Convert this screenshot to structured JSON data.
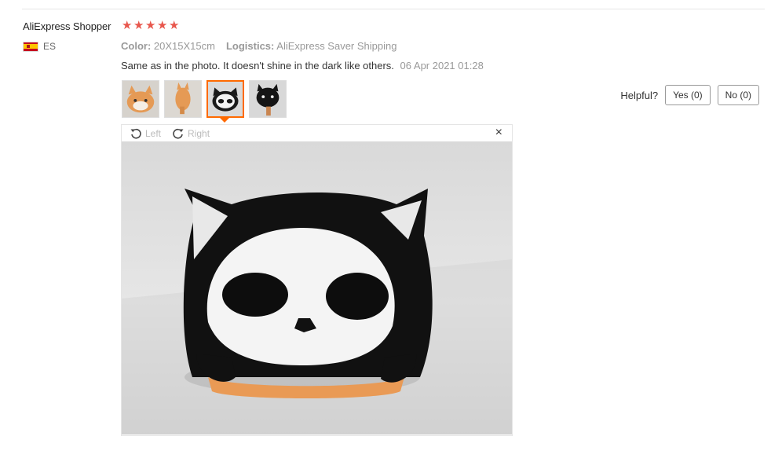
{
  "user": {
    "name": "AliExpress Shopper",
    "country_code": "ES",
    "rating": 5
  },
  "colors": {
    "star": "#e8574d",
    "accent": "#ff6a00"
  },
  "review": {
    "color_label": "Color:",
    "color_value": "20X15X15cm",
    "logistics_label": "Logistics:",
    "logistics_value": "AliExpress Saver Shipping",
    "text": "Same as in the photo. It doesn't shine in the dark like others.",
    "date": "06 Apr 2021 01:28"
  },
  "helpful": {
    "label": "Helpful?",
    "yes": "Yes (0)",
    "no": "No (0)"
  },
  "viewer": {
    "rotate_left": "Left",
    "rotate_right": "Right",
    "close": "×",
    "active_thumb_index": 2
  },
  "thumbnails": [
    {
      "icon": "orange-cat-plush"
    },
    {
      "icon": "orange-cat-plush-side"
    },
    {
      "icon": "skull-cat-plush"
    },
    {
      "icon": "black-cat-plush"
    }
  ]
}
